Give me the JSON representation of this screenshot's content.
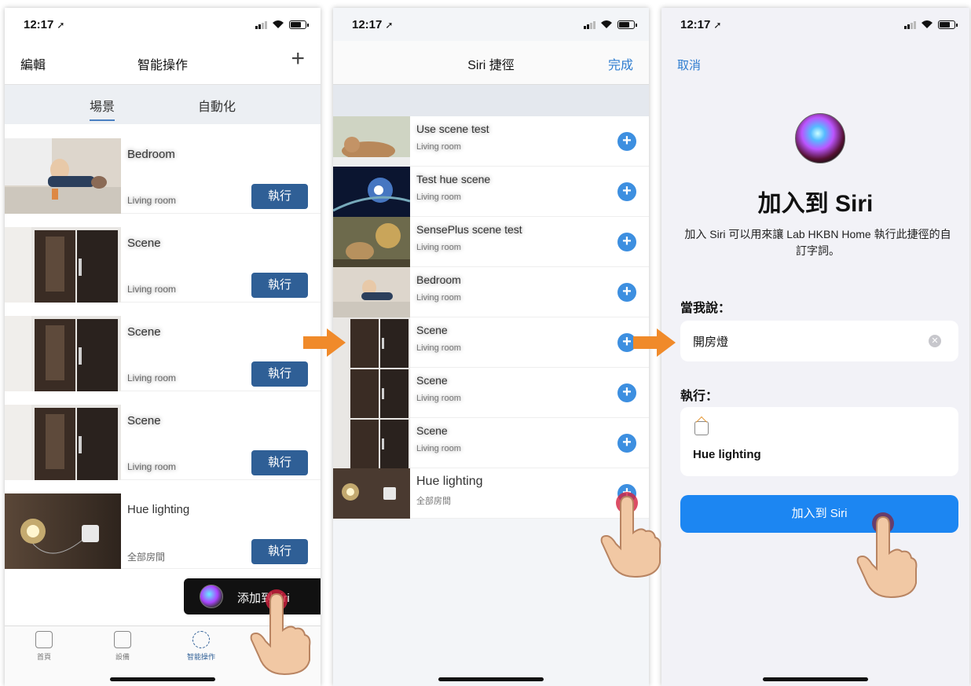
{
  "accent": "#2f5f96",
  "ios_blue": "#1c86f2",
  "panel1": {
    "time": "12:17",
    "nav": {
      "edit": "編輯",
      "title": "智能操作",
      "add": "+"
    },
    "segments": [
      "場景",
      "自動化"
    ],
    "scenes": [
      {
        "name": "",
        "room": "",
        "run": "執行",
        "thumb": "mom-baby-photo"
      },
      {
        "name": "",
        "room": "",
        "run": "執行",
        "thumb": "door-photo"
      },
      {
        "name": "",
        "room": "",
        "run": "執行",
        "thumb": "door-photo"
      },
      {
        "name": "",
        "room": "",
        "run": "執行",
        "thumb": "door-photo"
      },
      {
        "name": "Hue lighting",
        "room": "全部房間",
        "run": "執行",
        "thumb": "lamp-photo"
      }
    ],
    "siri_toast": "添加到Siri",
    "tabs": [
      {
        "label": "首頁",
        "icon": "home-icon"
      },
      {
        "label": "設備",
        "icon": "devices-icon"
      },
      {
        "label": "智能操作",
        "icon": "smart-actions-icon"
      }
    ]
  },
  "panel2": {
    "time": "12:17",
    "nav": {
      "title": "Siri 捷徑",
      "done": "完成"
    },
    "shortcuts": [
      {
        "name": "",
        "room": "",
        "thumb": "cat-photo"
      },
      {
        "name": "",
        "room": "",
        "thumb": "space-photo"
      },
      {
        "name": "",
        "room": "",
        "thumb": "dog-fan-photo"
      },
      {
        "name": "",
        "room": "",
        "thumb": "mom-baby-photo"
      },
      {
        "name": "",
        "room": "",
        "thumb": "door-photo"
      },
      {
        "name": "",
        "room": "",
        "thumb": "door-photo"
      },
      {
        "name": "",
        "room": "",
        "thumb": "door-photo"
      },
      {
        "name": "Hue lighting",
        "room": "全部房間",
        "thumb": "lamp-photo"
      }
    ]
  },
  "panel3": {
    "time": "12:17",
    "cancel": "取消",
    "title": "加入到 Siri",
    "description": "加入 Siri 可以用來讓 Lab HKBN Home 執行此捷徑的自訂字詞。",
    "when_i_say_label": "當我說：",
    "phrase_value": "開房燈",
    "do_label": "執行：",
    "action_name": "Hue lighting",
    "add_button": "加入到 Siri"
  }
}
